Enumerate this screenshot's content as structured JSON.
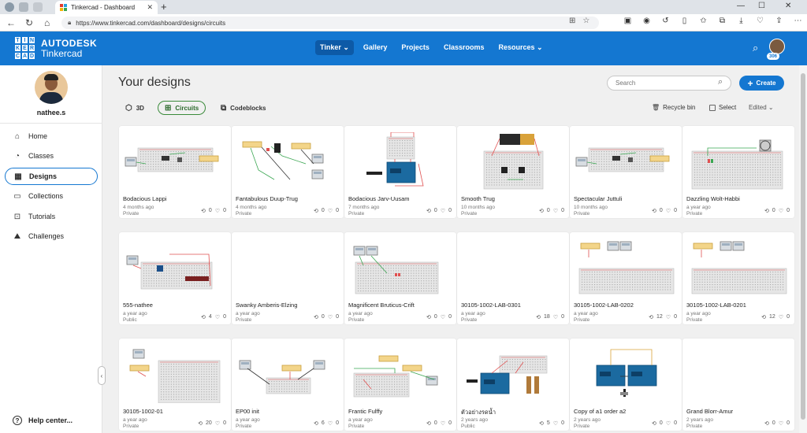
{
  "browser": {
    "tab_title": "Tinkercad - Dashboard",
    "url": "https://www.tinkercad.com/dashboard/designs/circuits",
    "new_tab": "+",
    "min": "—",
    "max": "☐",
    "close": "✕"
  },
  "header": {
    "logo_letters": [
      "T",
      "I",
      "N",
      "K",
      "E",
      "R",
      "C",
      "A",
      "D"
    ],
    "brand_top": "AUTODESK",
    "brand_bottom": "Tinkercad",
    "nav": [
      {
        "label": "Tinker ⌄"
      },
      {
        "label": "Gallery"
      },
      {
        "label": "Projects"
      },
      {
        "label": "Classrooms"
      },
      {
        "label": "Resources ⌄"
      }
    ],
    "badge": "306"
  },
  "sidebar": {
    "user_name": "nathee.s",
    "items": [
      {
        "label": "Home",
        "icon": "⌂"
      },
      {
        "label": "Classes",
        "icon": "◔"
      },
      {
        "label": "Designs",
        "icon": "▦"
      },
      {
        "label": "Collections",
        "icon": "▭"
      },
      {
        "label": "Tutorials",
        "icon": "⊡"
      },
      {
        "label": "Challenges",
        "icon": "⛰"
      }
    ],
    "help": "Help center..."
  },
  "main": {
    "title": "Your designs",
    "search_placeholder": "Search",
    "create_label": "Create",
    "filters": [
      {
        "label": "3D",
        "icon": "⬡"
      },
      {
        "label": "Circuits",
        "icon": "⊞"
      },
      {
        "label": "Codeblocks",
        "icon": "⧉"
      }
    ],
    "recycle_label": "Recycle bin",
    "select_label": "Select",
    "sort_label": "Edited ⌄"
  },
  "designs": [
    {
      "name": "Bodacious Lappi",
      "date": "4 months ago",
      "visibility": "Private",
      "remixes": "0",
      "likes": "0",
      "thumb": "bb-lcd"
    },
    {
      "name": "Fantabulous Duup-Trug",
      "date": "4 months ago",
      "visibility": "Private",
      "remixes": "0",
      "likes": "0",
      "thumb": "wires"
    },
    {
      "name": "Bodacious Jarv-Uusam",
      "date": "7 months ago",
      "visibility": "Private",
      "remixes": "0",
      "likes": "0",
      "thumb": "arduino"
    },
    {
      "name": "Smooth Trug",
      "date": "10 months ago",
      "visibility": "Private",
      "remixes": "0",
      "likes": "0",
      "thumb": "battery"
    },
    {
      "name": "Spectacular Juttuli",
      "date": "10 months ago",
      "visibility": "Private",
      "remixes": "0",
      "likes": "0",
      "thumb": "bb-lcd"
    },
    {
      "name": "Dazzling Wolt-Habbi",
      "date": "a year ago",
      "visibility": "Private",
      "remixes": "0",
      "likes": "0",
      "thumb": "scope"
    },
    {
      "name": "555-nathee",
      "date": "a year ago",
      "visibility": "Public",
      "remixes": "4",
      "likes": "0",
      "thumb": "bb-red"
    },
    {
      "name": "Swanky Amberis-Elzing",
      "date": "a year ago",
      "visibility": "Private",
      "remixes": "0",
      "likes": "0",
      "thumb": "blank"
    },
    {
      "name": "Magnificent Bruticus-Crift",
      "date": "a year ago",
      "visibility": "Private",
      "remixes": "0",
      "likes": "0",
      "thumb": "bb-small"
    },
    {
      "name": "30105-1002-LAB-0301",
      "date": "a year ago",
      "visibility": "Private",
      "remixes": "18",
      "likes": "0",
      "thumb": "blank"
    },
    {
      "name": "30105-1002-LAB-0202",
      "date": "a year ago",
      "visibility": "Private",
      "remixes": "12",
      "likes": "0",
      "thumb": "bb-plain"
    },
    {
      "name": "30105-1002-LAB-0201",
      "date": "a year ago",
      "visibility": "Private",
      "remixes": "12",
      "likes": "0",
      "thumb": "bb-plain"
    },
    {
      "name": "30105-1002-01",
      "date": "a year ago",
      "visibility": "Private",
      "remixes": "20",
      "likes": "0",
      "thumb": "bb-tall"
    },
    {
      "name": "EP00 init",
      "date": "a year ago",
      "visibility": "Private",
      "remixes": "6",
      "likes": "0",
      "thumb": "wires2"
    },
    {
      "name": "Frantic Fulffy",
      "date": "a year ago",
      "visibility": "Private",
      "remixes": "0",
      "likes": "0",
      "thumb": "wires3"
    },
    {
      "name": "ตัวอย่างรดน้ำ",
      "date": "2 years ago",
      "visibility": "Public",
      "remixes": "5",
      "likes": "0",
      "thumb": "arduino2"
    },
    {
      "name": "Copy of a1 order a2",
      "date": "2 years ago",
      "visibility": "Private",
      "remixes": "0",
      "likes": "0",
      "thumb": "arduino3"
    },
    {
      "name": "Grand Blorr-Amur",
      "date": "2 years ago",
      "visibility": "Private",
      "remixes": "0",
      "likes": "0",
      "thumb": "blank"
    }
  ]
}
